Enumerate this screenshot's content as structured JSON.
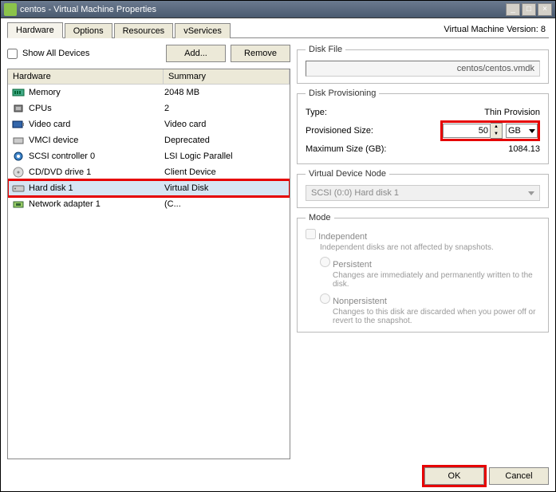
{
  "window": {
    "title": "centos - Virtual Machine Properties"
  },
  "tabs": [
    "Hardware",
    "Options",
    "Resources",
    "vServices"
  ],
  "version": "Virtual Machine Version: 8",
  "showAllDevices": "Show All Devices",
  "addBtn": "Add...",
  "removeBtn": "Remove",
  "headers": {
    "hw": "Hardware",
    "sum": "Summary"
  },
  "devices": [
    {
      "icon": "memory",
      "name": "Memory",
      "summary": "2048 MB"
    },
    {
      "icon": "cpu",
      "name": "CPUs",
      "summary": "2"
    },
    {
      "icon": "video",
      "name": "Video card",
      "summary": "Video card"
    },
    {
      "icon": "vmci",
      "name": "VMCI device",
      "summary": "Deprecated"
    },
    {
      "icon": "scsi",
      "name": "SCSI controller 0",
      "summary": "LSI Logic Parallel"
    },
    {
      "icon": "cd",
      "name": "CD/DVD drive 1",
      "summary": "Client Device"
    },
    {
      "icon": "hdd",
      "name": "Hard disk 1",
      "summary": "Virtual Disk",
      "selected": true
    },
    {
      "icon": "nic",
      "name": "Network adapter 1",
      "summary": "(C..."
    }
  ],
  "diskFile": {
    "legend": "Disk File",
    "value": "centos/centos.vmdk"
  },
  "provisioning": {
    "legend": "Disk Provisioning",
    "typeLabel": "Type:",
    "typeValue": "Thin Provision",
    "sizeLabel": "Provisioned Size:",
    "sizeValue": "50",
    "unit": "GB",
    "maxLabel": "Maximum Size (GB):",
    "maxValue": "1084.13"
  },
  "vnode": {
    "legend": "Virtual Device Node",
    "value": "SCSI (0:0) Hard disk 1"
  },
  "mode": {
    "legend": "Mode",
    "indep": "Independent",
    "indepDesc": "Independent disks are not affected by snapshots.",
    "persist": "Persistent",
    "persistDesc": "Changes are immediately and permanently written to the disk.",
    "nonpersist": "Nonpersistent",
    "nonpersistDesc": "Changes to this disk are discarded when you power off or revert to the snapshot."
  },
  "footer": {
    "ok": "OK",
    "cancel": "Cancel"
  }
}
